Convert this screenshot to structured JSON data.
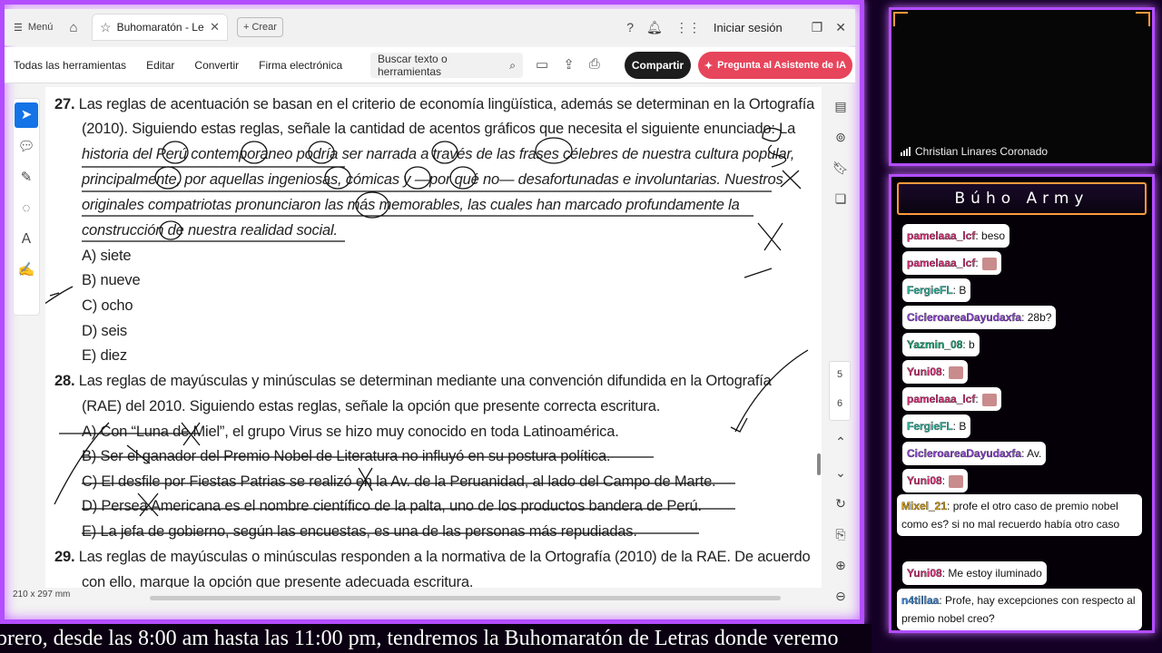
{
  "tabbar": {
    "menu_label": "Menú",
    "tab_title": "Buhomaratón - Leng...",
    "create_label": "Crear",
    "signin_label": "Iniciar sesión"
  },
  "toolbar": {
    "tools": [
      "Todas las herramientas",
      "Editar",
      "Convertir",
      "Firma electrónica"
    ],
    "search_placeholder": "Buscar texto o herramientas",
    "share_label": "Compartir",
    "ai_label": "Pregunta al Asistente de IA"
  },
  "document": {
    "q27": {
      "number": "27.",
      "line1": "Las reglas de acentuación se basan en el criterio de economía lingüística, además se determinan en la Ortografía",
      "line2": "(2010). Siguiendo estas reglas, señale la cantidad de acentos gráficos que necesita el siguiente enunciado: La",
      "line3": "historia del Perú contemporaneo podría ser narrada a través de las frases célebres de nuestra cultura popular,",
      "line4": "principalmente, por aquellas ingeniosas, cómicas y —por qué no— desafortunadas e involuntarias. Nuestros",
      "line5": "originales compatriotas pronunciaron las más memorables, las cuales han marcado profundamente la",
      "line6": "construcción de nuestra realidad social.",
      "options": [
        "A) siete",
        "B) nueve",
        "C) ocho",
        "D) seis",
        "E) diez"
      ]
    },
    "q28": {
      "number": "28.",
      "line1": "Las reglas de mayúsculas y minúsculas se determinan mediante una convención difundida en la Ortografía",
      "line2": "(RAE) del 2010. Siguiendo estas reglas, señale la opción que presente correcta escritura.",
      "options": [
        "A) Con “Luna de Miel”, el grupo Virus se hizo muy conocido en toda Latinoamérica.",
        "B) Ser el ganador del Premio Nobel de Literatura no influyó en su postura política.",
        "C) El desfile por Fiestas Patrias se realizó en la Av. de la Peruanidad, al lado del Campo de Marte.",
        "D) Persea Americana es el nombre científico de la palta, uno de los productos bandera de Perú.",
        "E) La jefa de gobierno, según las encuestas, es una de las personas más repudiadas."
      ]
    },
    "q29": {
      "number": "29.",
      "line1": "Las reglas de mayúsculas o minúsculas responden a la normativa de la Ortografía (2010) de la RAE. De acuerdo",
      "line2": "con ello, marque la opción que presente adecuada escritura."
    },
    "page_size": "210 x 297 mm",
    "page_numbers": [
      "5",
      "6"
    ]
  },
  "webcam": {
    "name": "Christian Linares Coronado"
  },
  "chat": {
    "title": "Búho Army",
    "messages": [
      {
        "user": "pamelaaa_lcf",
        "text": ": beso",
        "user_color": "#e0307a"
      },
      {
        "user": "pamelaaa_lcf",
        "text": ":",
        "user_color": "#e0307a",
        "emoji": true
      },
      {
        "user": "FergieFL",
        "text": ": B",
        "user_color": "#2fb7a0"
      },
      {
        "user": "CicleroareaDayudaxfa",
        "text": ": 28b?",
        "user_color": "#8e44d8"
      },
      {
        "user": "Yazmin_08",
        "text": ": b",
        "user_color": "#1fa877"
      },
      {
        "user": "Yuni08",
        "text": ":",
        "user_color": "#e0307a",
        "emoji": true
      },
      {
        "user": "pamelaaa_lcf",
        "text": ":",
        "user_color": "#e0307a",
        "emoji": true
      },
      {
        "user": "FergieFL",
        "text": ": B",
        "user_color": "#2fb7a0"
      },
      {
        "user": "CicleroareaDayudaxfa",
        "text": ": Av.",
        "user_color": "#8e44d8"
      },
      {
        "user": "Yuni08",
        "text": ":",
        "user_color": "#e0307a",
        "emoji": true
      },
      {
        "user": "Mixel_21",
        "text": ": profe el otro caso de premio nobel como es? si no mal recuerdo había otro caso",
        "user_color": "#d9a012"
      },
      {
        "user": "Yuni08",
        "text": ": Me estoy iluminado",
        "user_color": "#e0307a"
      },
      {
        "user": "n4tillaa",
        "text": ": Profe, hay excepciones con respecto al premio nobel creo?",
        "user_color": "#3a8be0"
      }
    ]
  },
  "ticker": {
    "text": "brero, desde las 8:00 am hasta las 11:00 pm, tendremos la Buhomaratón de Letras donde veremo"
  },
  "colors": {
    "frame": "#b34dff",
    "accent_orange": "#ff9a3d",
    "share": "#1d1d1d",
    "ai": "#e7455b"
  }
}
